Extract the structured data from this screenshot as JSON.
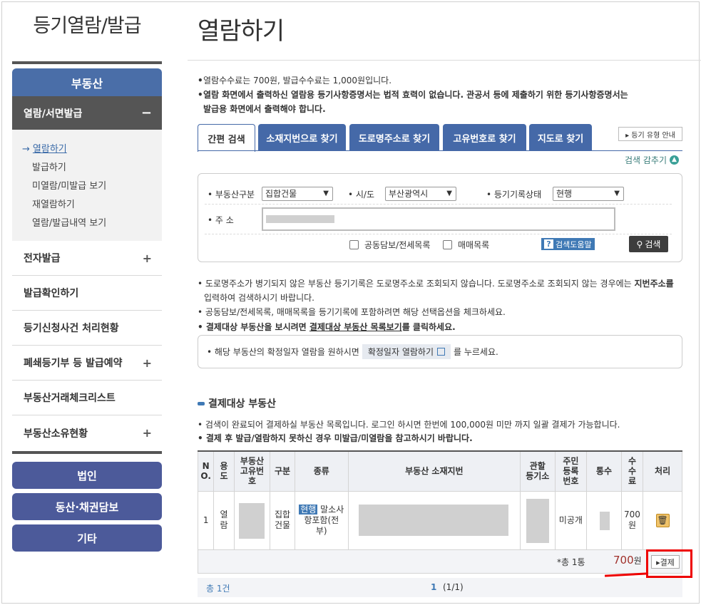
{
  "sidebar": {
    "title": "등기열람/발급",
    "main_button": "부동산",
    "sub_head": "열람/서면발급",
    "sub_head_icon": "minus-icon",
    "sub_items": [
      "열람하기",
      "발급하기",
      "미열람/미발급 보기",
      "재열람하기",
      "열람/발급내역 보기"
    ],
    "menu": [
      {
        "label": "전자발급",
        "plus": "+"
      },
      {
        "label": "발급확인하기",
        "plus": ""
      },
      {
        "label": "등기신청사건 처리현황",
        "plus": ""
      },
      {
        "label": "폐쇄등기부 등 발급예약",
        "plus": "+"
      },
      {
        "label": "부동산거래체크리스트",
        "plus": ""
      },
      {
        "label": "부동산소유현황",
        "plus": "+"
      }
    ],
    "buttons": [
      "법인",
      "동산·채권담보",
      "기타"
    ]
  },
  "main": {
    "title": "열람하기",
    "notices": [
      "열람수수료는 700원, 발급수수료는 1,000원입니다.",
      "열람 화면에서 출력하신 열람용 등기사항증명서는 법적 효력이 없습니다. 관공서 등에 제출하기 위한 등기사항증명서는",
      "발급용 화면에서 출력해야 합니다."
    ],
    "tabs": [
      "간편 검색",
      "소재지번으로 찾기",
      "도로명주소로 찾기",
      "고유번호로 찾기",
      "지도로 찾기"
    ],
    "help_button": "▸ 등기 유형 안내",
    "collapse_label": "검색 감추기",
    "search": {
      "type_label": "• 부동산구분",
      "type_value": "집합건물",
      "city_label": "• 시/도",
      "city_value": "부산광역시",
      "status_label": "• 등기기록상태",
      "status_value": "현행",
      "addr_label": "• 주 소",
      "check1": "공동담보/전세목록",
      "check2": "매매목록",
      "help": "검색도움말",
      "button": "검색"
    },
    "info": [
      "도로명주소가 병기되지 않은 부동산 등기기록은 도로명주소로 조회되지 않습니다. 도로명주소로 조회되지 않는 경우에는",
      "지번주소를",
      "입력하여 검색하시기 바랍니다.",
      "공동담보/전세목록, 매매목록을 등기기록에 포함하려면 해당 선택옵션을 체크하세요.",
      "결제대상 부동산을 보시려면",
      "결제대상 부동산 목록보기",
      "를 클릭하세요."
    ],
    "hint": {
      "pre": "• 해당 부동산의 확정일자 열람을 원하시면",
      "button": "확정일자 열람하기",
      "post": "를 누르세요."
    },
    "section_title": "결제대상 부동산",
    "section_notes": [
      "검색이 완료되어 결제하실 부동산 목록입니다. 로그인 하시면 한번에 100,000원 미만 까지 일괄 결제가 가능합니다.",
      "결제 후 발급/열람하지 못하신 경우 미발급/미열람을 참고하시기 바랍니다."
    ],
    "table": {
      "headers": [
        "N\nO.",
        "용\n도",
        "부동산\n고유번\n호",
        "구분",
        "종류",
        "부동산 소재지번",
        "관할\n등기소",
        "주민\n등록\n번호",
        "통수",
        "수\n수\n료",
        "처리"
      ],
      "row": {
        "no": "1",
        "use": "열\n람",
        "category": "집합\n건물",
        "kind_badge": "현행",
        "kind_text": " 말소사\n항포함(전\n부)",
        "resident": "미공개",
        "fee": "700\n원"
      },
      "total_count": "*총 1통",
      "total_amount": "700",
      "total_unit": "원",
      "pay_button": "▸결제",
      "pager_total": "총 1건",
      "pager_page": "1",
      "pager_of": "(1/1)"
    }
  }
}
